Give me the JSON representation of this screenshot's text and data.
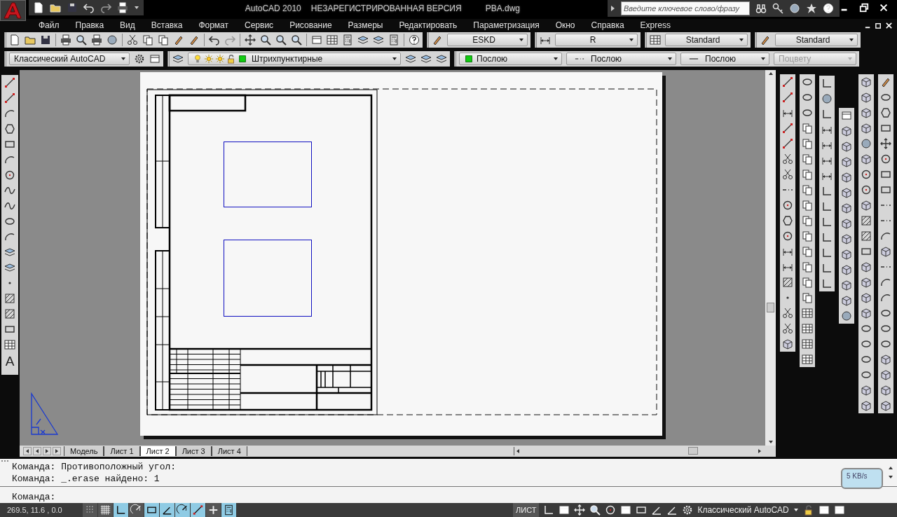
{
  "title_bar": {
    "title_parts": [
      "AutoCAD 2010",
      "НЕЗАРЕГИСТРИРОВАННАЯ ВЕРСИЯ",
      "PBA.dwg"
    ],
    "search": {
      "placeholder": "Введите ключевое слово/фразу"
    }
  },
  "menu": [
    "Файл",
    "Правка",
    "Вид",
    "Вставка",
    "Формат",
    "Сервис",
    "Рисование",
    "Размеры",
    "Редактировать",
    "Параметризация",
    "Окно",
    "Справка",
    "Express"
  ],
  "styles_toolbar": [
    {
      "kind": "text-style",
      "value": "ESKD"
    },
    {
      "kind": "dim-style",
      "value": "R"
    },
    {
      "kind": "table-style",
      "value": "Standard"
    },
    {
      "kind": "mleader-style",
      "value": "Standard"
    }
  ],
  "workspace": {
    "value": "Классический AutoCAD"
  },
  "layer": {
    "value": "Штрихпунктирные"
  },
  "properties": [
    {
      "kind": "color",
      "value": "Послою",
      "disabled": false
    },
    {
      "kind": "linetype",
      "value": "Послою",
      "disabled": false
    },
    {
      "kind": "lineweight",
      "value": "Послою",
      "disabled": false
    },
    {
      "kind": "plotstyle",
      "value": "Поцвету",
      "disabled": true
    }
  ],
  "left_toolbar_glyph": "A",
  "layout_tabs": [
    {
      "label": "Модель",
      "selected": false
    },
    {
      "label": "Лист 1",
      "selected": false
    },
    {
      "label": "Лист 2",
      "selected": true
    },
    {
      "label": "Лист 3",
      "selected": false
    },
    {
      "label": "Лист 4",
      "selected": false
    }
  ],
  "command_line": {
    "history": [
      "Команда: Противоположный угол:",
      "Команда: _.erase найдено: 1"
    ],
    "prompt": "Команда:"
  },
  "network_widget": {
    "speed": "5 KB/s"
  },
  "status_bar": {
    "coordinates": "269.5, 11.6 , 0.0",
    "toggles": [
      {
        "on": false
      },
      {
        "on": false
      },
      {
        "on": true
      },
      {
        "on": false
      },
      {
        "on": true
      },
      {
        "on": true
      },
      {
        "on": true
      },
      {
        "on": true
      },
      {
        "on": false
      },
      {
        "on": true
      }
    ],
    "space": "ЛИСТ",
    "workspace": "Классический AutoCAD"
  }
}
